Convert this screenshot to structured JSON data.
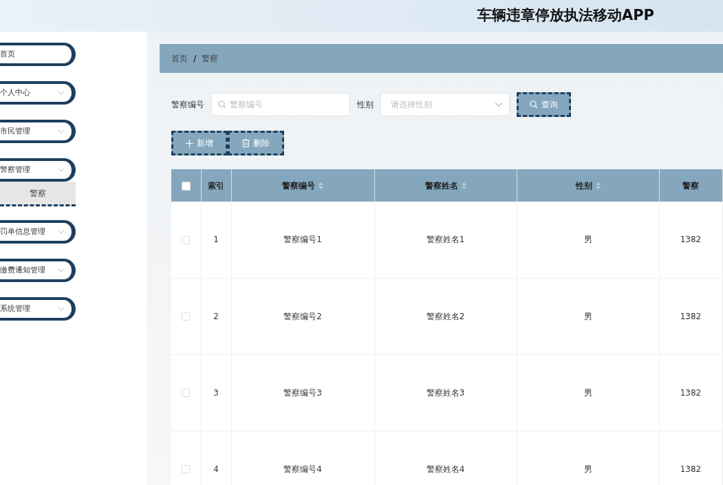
{
  "app_title": "车辆违章停放执法移动APP",
  "sidebar": {
    "items": [
      {
        "label": "首页",
        "kind": "link"
      },
      {
        "label": "个人中心",
        "kind": "menu"
      },
      {
        "label": "市民管理",
        "kind": "menu"
      },
      {
        "label": "警察管理",
        "kind": "menu",
        "children": [
          {
            "label": "警察",
            "selected": true
          }
        ]
      },
      {
        "label": "罚单信息管理",
        "kind": "menu"
      },
      {
        "label": "缴费通知管理",
        "kind": "menu"
      },
      {
        "label": "系统管理",
        "kind": "menu"
      }
    ]
  },
  "breadcrumb": {
    "items": [
      "首页",
      "警察"
    ],
    "separator": "/"
  },
  "search": {
    "fields": [
      {
        "label": "警察编号",
        "kind": "text",
        "placeholder": "警察编号"
      },
      {
        "label": "性别",
        "kind": "select",
        "placeholder": "请选择性别"
      }
    ],
    "button": "查询"
  },
  "actions": [
    {
      "label": "新增",
      "kind": "add"
    },
    {
      "label": "删除",
      "kind": "delete"
    }
  ],
  "table": {
    "select_all_checked": false,
    "columns": [
      {
        "label": "索引",
        "sortable": false
      },
      {
        "label": "警察编号",
        "sortable": true
      },
      {
        "label": "警察姓名",
        "sortable": true
      },
      {
        "label": "性别",
        "sortable": true
      },
      {
        "label": "警察",
        "sortable": false
      }
    ],
    "rows": [
      {
        "checked": false,
        "cells": [
          "1",
          "警察编号1",
          "警察姓名1",
          "男",
          "1382"
        ]
      },
      {
        "checked": false,
        "cells": [
          "2",
          "警察编号2",
          "警察姓名2",
          "男",
          "1382"
        ]
      },
      {
        "checked": false,
        "cells": [
          "3",
          "警察编号3",
          "警察姓名3",
          "男",
          "1382"
        ]
      },
      {
        "checked": false,
        "cells": [
          "4",
          "警察编号4",
          "警察姓名4",
          "男",
          "1382"
        ]
      }
    ]
  }
}
